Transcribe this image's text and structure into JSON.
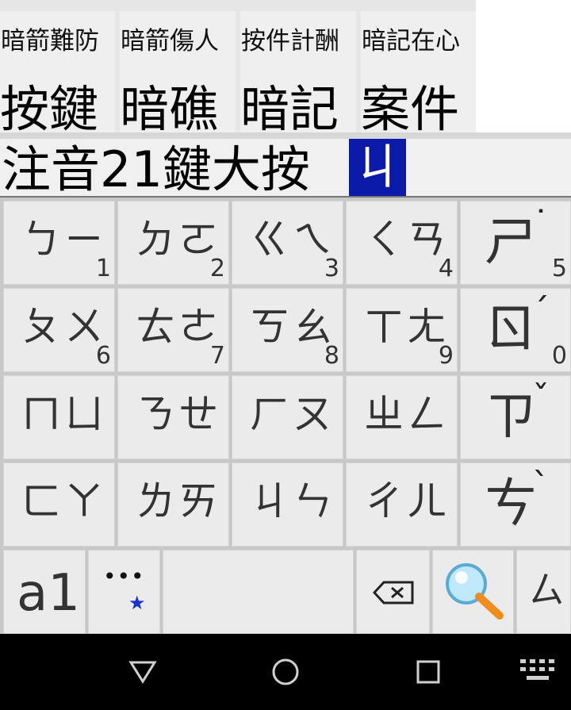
{
  "candidates": [
    {
      "hint": "暗箭難防",
      "word": "按鍵"
    },
    {
      "hint": "暗箭傷人",
      "word": "暗礁"
    },
    {
      "hint": "按件計酬",
      "word": "暗記"
    },
    {
      "hint": "暗記在心",
      "word": "案件"
    }
  ],
  "composing": {
    "text": "注音21鍵大按",
    "cursor_char": "ㄐ"
  },
  "keys": [
    {
      "main": "ㄅㄧ",
      "num": "1"
    },
    {
      "main": "ㄉㄛ",
      "num": "2"
    },
    {
      "main": "ㄍㄟ",
      "num": "3"
    },
    {
      "main": "ㄑㄢ",
      "num": "4"
    },
    {
      "main": "ㄕ",
      "tone": "˙",
      "num": "5"
    },
    {
      "main": "ㄆㄨ",
      "num": "6"
    },
    {
      "main": "ㄊㄜ",
      "num": "7"
    },
    {
      "main": "ㄎㄠ",
      "num": "8"
    },
    {
      "main": "ㄒㄤ",
      "num": "9"
    },
    {
      "main": "ㄖ",
      "tone": "ˊ",
      "num": "0"
    },
    {
      "main": "ㄇㄩ"
    },
    {
      "main": "ㄋㄝ"
    },
    {
      "main": "ㄏㄡ"
    },
    {
      "main": "ㄓㄥ"
    },
    {
      "main": "ㄗ",
      "tone": "ˇ"
    },
    {
      "main": "ㄈㄚ"
    },
    {
      "main": "ㄌㄞ"
    },
    {
      "main": "ㄐㄣ"
    },
    {
      "main": "ㄔㄦ"
    },
    {
      "main": "ㄘ",
      "tone": "ˋ"
    }
  ],
  "bottom": {
    "mode_label": "a1",
    "more_label": "•••",
    "star": "★",
    "last_key": "ㄙ"
  },
  "colors": {
    "cursor_bg": "#0b1aa8",
    "star": "#1a2fd6",
    "search_lens": "#6ec6f0",
    "search_handle": "#f08c1e"
  },
  "icons": {
    "backspace": "backspace-icon",
    "search": "search-icon",
    "back": "nav-back-icon",
    "home": "nav-home-icon",
    "recents": "nav-recents-icon",
    "keyboard": "keyboard-switch-icon"
  }
}
